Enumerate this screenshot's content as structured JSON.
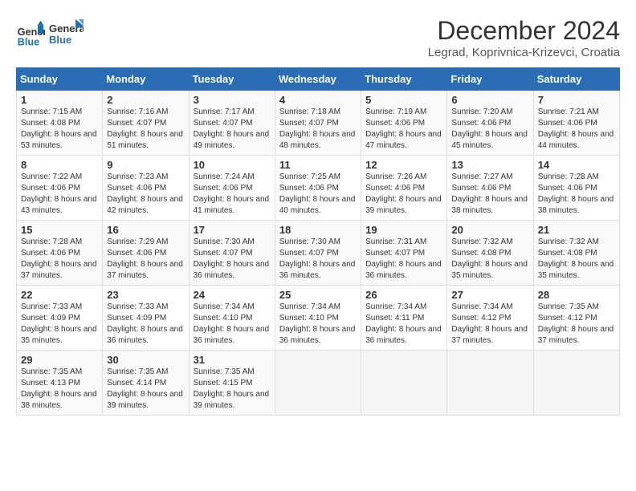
{
  "header": {
    "logo_line1": "General",
    "logo_line2": "Blue",
    "month": "December 2024",
    "location": "Legrad, Koprivnica-Krizevci, Croatia"
  },
  "weekdays": [
    "Sunday",
    "Monday",
    "Tuesday",
    "Wednesday",
    "Thursday",
    "Friday",
    "Saturday"
  ],
  "weeks": [
    [
      {
        "day": "1",
        "sunrise": "7:15 AM",
        "sunset": "4:08 PM",
        "daylight": "8 hours and 53 minutes."
      },
      {
        "day": "2",
        "sunrise": "7:16 AM",
        "sunset": "4:07 PM",
        "daylight": "8 hours and 51 minutes."
      },
      {
        "day": "3",
        "sunrise": "7:17 AM",
        "sunset": "4:07 PM",
        "daylight": "8 hours and 49 minutes."
      },
      {
        "day": "4",
        "sunrise": "7:18 AM",
        "sunset": "4:07 PM",
        "daylight": "8 hours and 48 minutes."
      },
      {
        "day": "5",
        "sunrise": "7:19 AM",
        "sunset": "4:06 PM",
        "daylight": "8 hours and 47 minutes."
      },
      {
        "day": "6",
        "sunrise": "7:20 AM",
        "sunset": "4:06 PM",
        "daylight": "8 hours and 45 minutes."
      },
      {
        "day": "7",
        "sunrise": "7:21 AM",
        "sunset": "4:06 PM",
        "daylight": "8 hours and 44 minutes."
      }
    ],
    [
      {
        "day": "8",
        "sunrise": "7:22 AM",
        "sunset": "4:06 PM",
        "daylight": "8 hours and 43 minutes."
      },
      {
        "day": "9",
        "sunrise": "7:23 AM",
        "sunset": "4:06 PM",
        "daylight": "8 hours and 42 minutes."
      },
      {
        "day": "10",
        "sunrise": "7:24 AM",
        "sunset": "4:06 PM",
        "daylight": "8 hours and 41 minutes."
      },
      {
        "day": "11",
        "sunrise": "7:25 AM",
        "sunset": "4:06 PM",
        "daylight": "8 hours and 40 minutes."
      },
      {
        "day": "12",
        "sunrise": "7:26 AM",
        "sunset": "4:06 PM",
        "daylight": "8 hours and 39 minutes."
      },
      {
        "day": "13",
        "sunrise": "7:27 AM",
        "sunset": "4:06 PM",
        "daylight": "8 hours and 38 minutes."
      },
      {
        "day": "14",
        "sunrise": "7:28 AM",
        "sunset": "4:06 PM",
        "daylight": "8 hours and 38 minutes."
      }
    ],
    [
      {
        "day": "15",
        "sunrise": "7:28 AM",
        "sunset": "4:06 PM",
        "daylight": "8 hours and 37 minutes."
      },
      {
        "day": "16",
        "sunrise": "7:29 AM",
        "sunset": "4:06 PM",
        "daylight": "8 hours and 37 minutes."
      },
      {
        "day": "17",
        "sunrise": "7:30 AM",
        "sunset": "4:07 PM",
        "daylight": "8 hours and 36 minutes."
      },
      {
        "day": "18",
        "sunrise": "7:30 AM",
        "sunset": "4:07 PM",
        "daylight": "8 hours and 36 minutes."
      },
      {
        "day": "19",
        "sunrise": "7:31 AM",
        "sunset": "4:07 PM",
        "daylight": "8 hours and 36 minutes."
      },
      {
        "day": "20",
        "sunrise": "7:32 AM",
        "sunset": "4:08 PM",
        "daylight": "8 hours and 35 minutes."
      },
      {
        "day": "21",
        "sunrise": "7:32 AM",
        "sunset": "4:08 PM",
        "daylight": "8 hours and 35 minutes."
      }
    ],
    [
      {
        "day": "22",
        "sunrise": "7:33 AM",
        "sunset": "4:09 PM",
        "daylight": "8 hours and 35 minutes."
      },
      {
        "day": "23",
        "sunrise": "7:33 AM",
        "sunset": "4:09 PM",
        "daylight": "8 hours and 36 minutes."
      },
      {
        "day": "24",
        "sunrise": "7:34 AM",
        "sunset": "4:10 PM",
        "daylight": "8 hours and 36 minutes."
      },
      {
        "day": "25",
        "sunrise": "7:34 AM",
        "sunset": "4:10 PM",
        "daylight": "8 hours and 36 minutes."
      },
      {
        "day": "26",
        "sunrise": "7:34 AM",
        "sunset": "4:11 PM",
        "daylight": "8 hours and 36 minutes."
      },
      {
        "day": "27",
        "sunrise": "7:34 AM",
        "sunset": "4:12 PM",
        "daylight": "8 hours and 37 minutes."
      },
      {
        "day": "28",
        "sunrise": "7:35 AM",
        "sunset": "4:12 PM",
        "daylight": "8 hours and 37 minutes."
      }
    ],
    [
      {
        "day": "29",
        "sunrise": "7:35 AM",
        "sunset": "4:13 PM",
        "daylight": "8 hours and 38 minutes."
      },
      {
        "day": "30",
        "sunrise": "7:35 AM",
        "sunset": "4:14 PM",
        "daylight": "8 hours and 39 minutes."
      },
      {
        "day": "31",
        "sunrise": "7:35 AM",
        "sunset": "4:15 PM",
        "daylight": "8 hours and 39 minutes."
      },
      null,
      null,
      null,
      null
    ]
  ]
}
